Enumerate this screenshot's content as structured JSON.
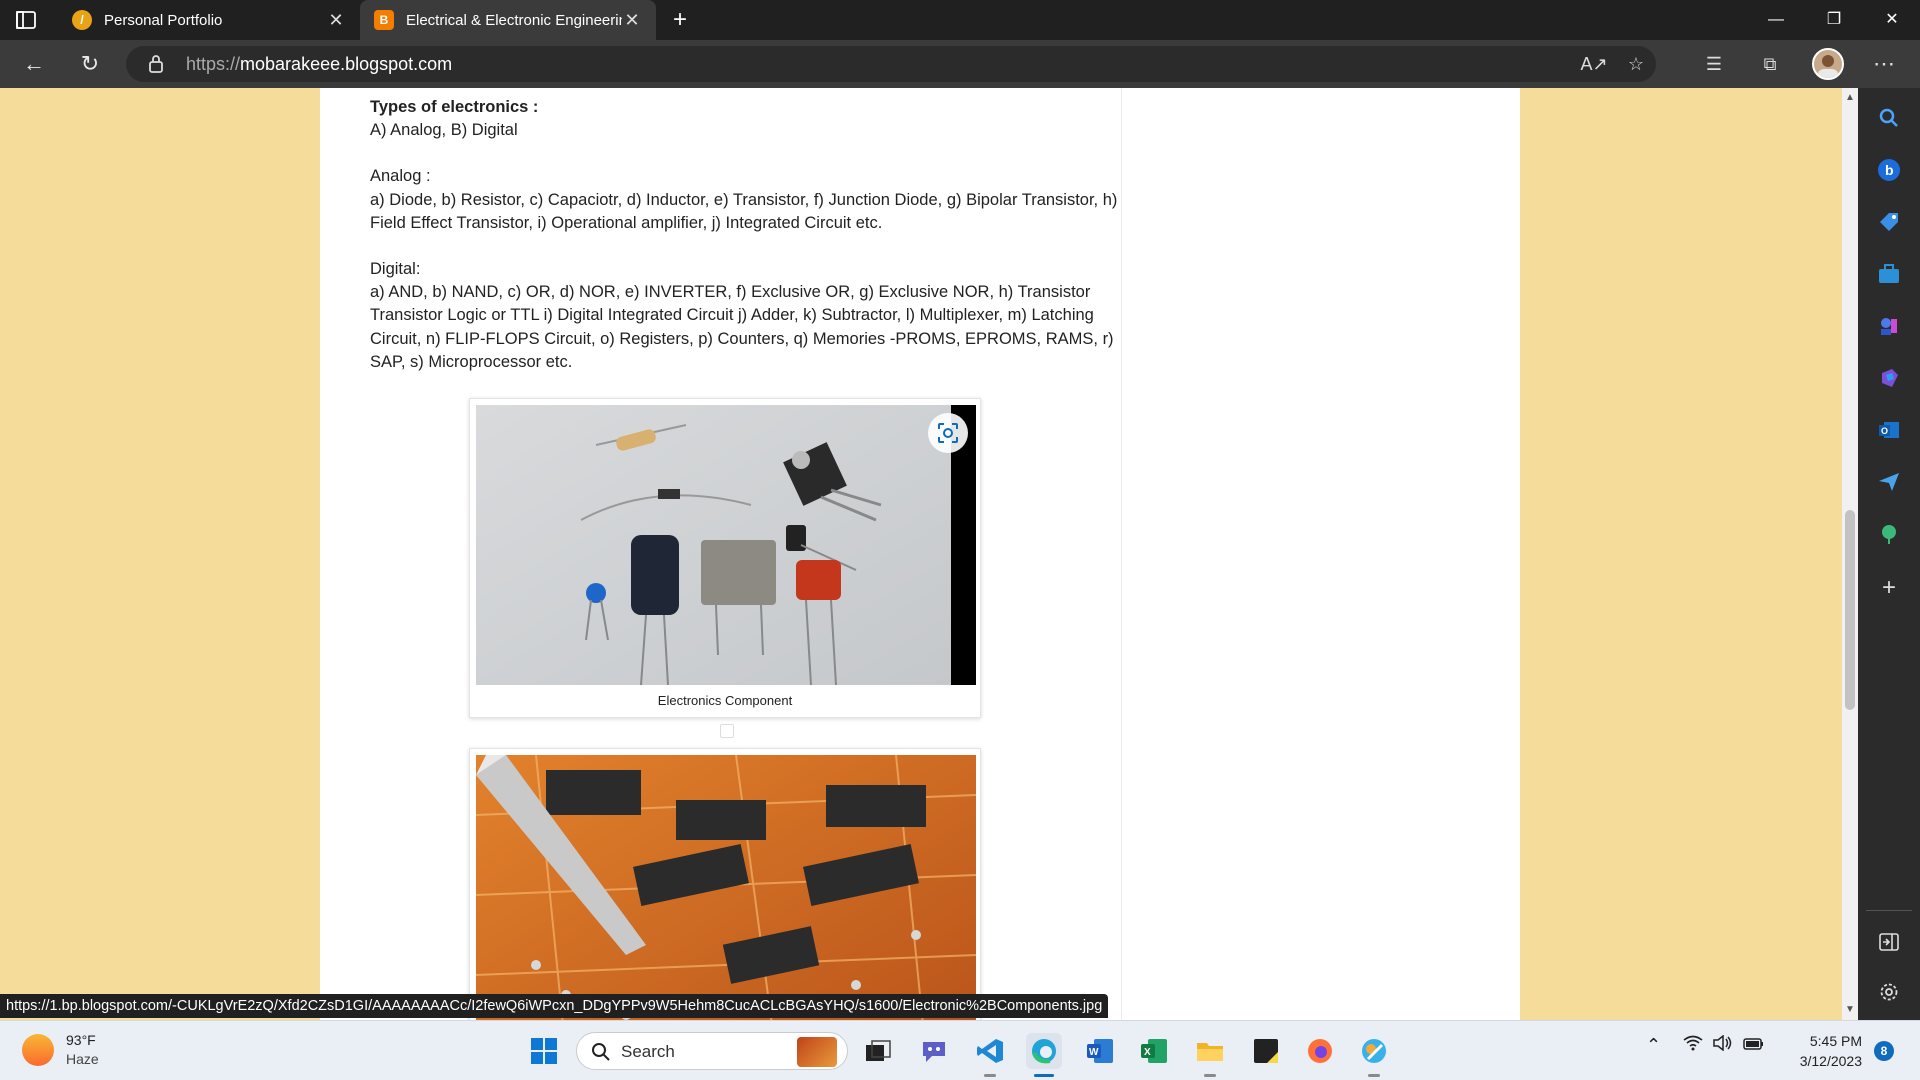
{
  "browser": {
    "tabs": [
      {
        "title": "Personal Portfolio",
        "favicon": "portfolio-icon",
        "active": false
      },
      {
        "title": "Electrical & Electronic Engineerin",
        "favicon": "blogger-icon",
        "active": true
      }
    ],
    "new_tab": "+",
    "address": {
      "protocol": "https://",
      "host": "mobarakeee.blogspot.com"
    },
    "status_url": "https://1.bp.blogspot.com/-CUKLgVrE2zQ/Xfd2CZsD1GI/AAAAAAAACc/I2fewQ6iWPcxn_DDgYPPv9W5Hehm8CucACLcBGAsYHQ/s1600/Electronic%2BComponents.jpg"
  },
  "post": {
    "heading": "Types of electronics :",
    "line_types": "A) Analog, B) Digital",
    "analog_label": "Analog :",
    "analog_list": " a) Diode, b) Resistor, c) Capaciotr, d) Inductor, e) Transistor, f) Junction Diode, g) Bipolar Transistor, h) Field Effect Transistor, i) Operational amplifier, j) Integrated Circuit etc.",
    "digital_label": "Digital:",
    "digital_list": "a) AND, b) NAND, c) OR, d) NOR, e) INVERTER, f) Exclusive OR, g) Exclusive NOR, h) Transistor Transistor Logic or TTL i) Digital Integrated Circuit j) Adder, k) Subtractor, l) Multiplexer, m) Latching Circuit, n) FLIP-FLOPS Circuit, o) Registers, p) Counters, q) Memories -PROMS, EPROMS, RAMS, r) SAP, s) Microprocessor  etc.",
    "figure1_caption": "Electronics Component"
  },
  "taskbar": {
    "weather_temp": "93°F",
    "weather_condition": "Haze",
    "search_placeholder": "Search",
    "time": "5:45 PM",
    "date": "3/12/2023",
    "notification_count": "8"
  },
  "colors": {
    "page_background": "#f6dc9b",
    "browser_dark": "#202020",
    "accent": "#0f6cbd"
  }
}
